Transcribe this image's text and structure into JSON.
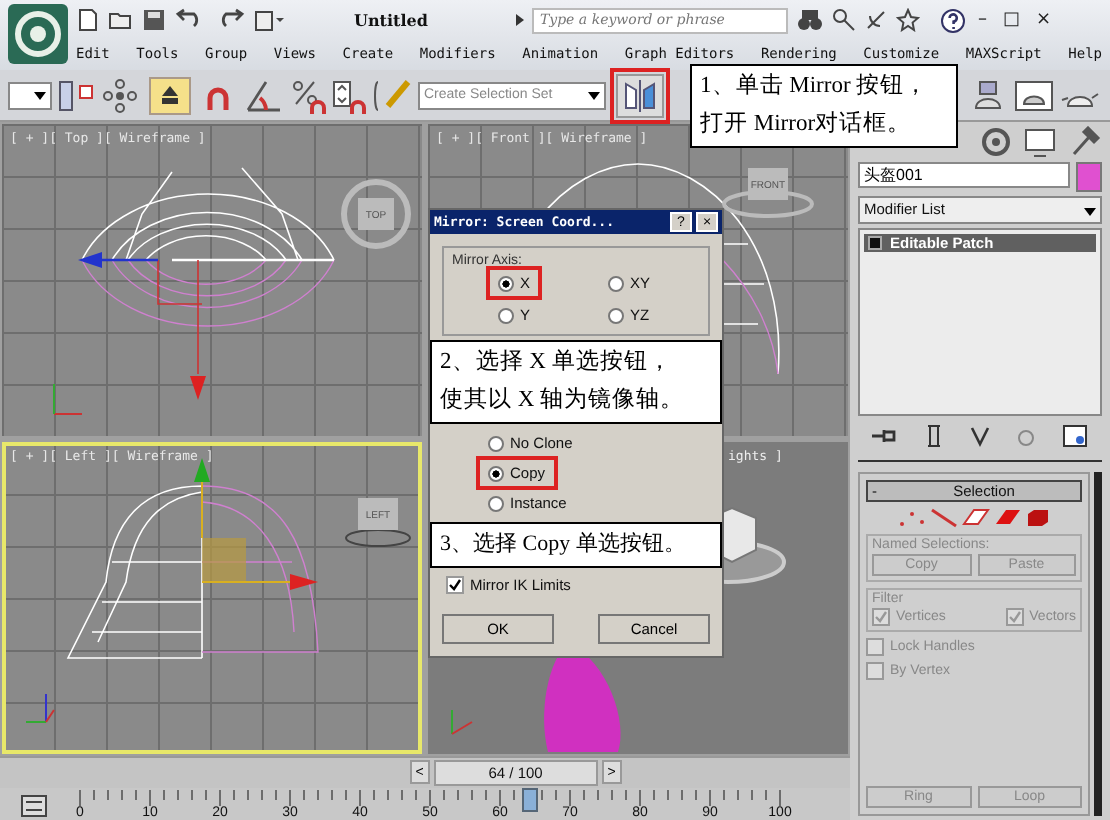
{
  "window": {
    "title": "Untitled",
    "search": {
      "placeholder": "Type a keyword or phrase"
    },
    "controls": [
      "–",
      "□",
      "×"
    ]
  },
  "menu": [
    "Edit",
    "Tools",
    "Group",
    "Views",
    "Create",
    "Modifiers",
    "Animation",
    "Graph Editors",
    "Rendering",
    "Customize",
    "MAXScript",
    "Help"
  ],
  "toolbar": {
    "selection_set": {
      "placeholder": "Create Selection Set"
    },
    "mirror": {
      "highlighted": true
    }
  },
  "callout_1": {
    "lines": [
      "1、单击 Mirror 按钮，",
      "打开 Mirror对话框。"
    ]
  },
  "viewports": [
    {
      "kind": "top",
      "label": "[ + ][ Top ][ Wireframe ]",
      "active": false,
      "cube_label": "TOP"
    },
    {
      "kind": "front",
      "label": "[ + ][ Front ][ Wireframe ]",
      "active": false,
      "cube_label": "FRONT"
    },
    {
      "kind": "left",
      "label": "[ + ][ Left ][ Wireframe ]",
      "active": true,
      "cube_label": "LEFT"
    },
    {
      "kind": "perspective",
      "label": "ights ]",
      "active": false
    }
  ],
  "dialog": {
    "title": "Mirror: Screen Coord...",
    "help": "?",
    "close": "×",
    "axis_group": "Mirror Axis:",
    "axes": [
      {
        "label": "X",
        "selected": true,
        "highlighted": true
      },
      {
        "label": "XY",
        "selected": false,
        "highlighted": false
      },
      {
        "label": "Y",
        "selected": false,
        "highlighted": false
      },
      {
        "label": "YZ",
        "selected": false,
        "highlighted": false
      }
    ],
    "callout_2": {
      "lines": [
        "2、选择 X 单选按钮，",
        "使其以 X 轴为镜像轴。"
      ]
    },
    "clone_options": [
      {
        "label": "No Clone",
        "selected": false,
        "highlighted": false
      },
      {
        "label": "Copy",
        "selected": true,
        "highlighted": true
      },
      {
        "label": "Instance",
        "selected": false,
        "highlighted": false
      }
    ],
    "callout_3": {
      "lines": [
        "3、选择 Copy 单选按钮。"
      ]
    },
    "ik_limits": {
      "label": "Mirror IK Limits",
      "checked": true
    },
    "buttons": [
      "OK",
      "Cancel"
    ]
  },
  "command_panel": {
    "object_name": "头盔001",
    "modifier_list": "Modifier List",
    "stack": [
      {
        "label": "Editable Patch",
        "selected": true
      }
    ],
    "rollout": {
      "toggle": "-",
      "title": "Selection"
    },
    "named_selections": {
      "title": "Named Selections:",
      "buttons": [
        "Copy",
        "Paste"
      ]
    },
    "filter": {
      "title": "Filter",
      "options": [
        {
          "label": "Vertices",
          "checked": true
        },
        {
          "label": "Vectors",
          "checked": true
        }
      ]
    },
    "options": [
      {
        "label": "Lock Handles",
        "checked": false
      },
      {
        "label": "By Vertex",
        "checked": false
      }
    ],
    "buttons": [
      "Ring",
      "Loop"
    ]
  },
  "time_slider": {
    "prev": "<",
    "reading": "64 / 100",
    "next": ">",
    "level": 0.64
  },
  "track_bar": {
    "ticks": [
      "0",
      "10",
      "20",
      "30",
      "40",
      "50",
      "60",
      "70",
      "80",
      "90",
      "100"
    ]
  }
}
